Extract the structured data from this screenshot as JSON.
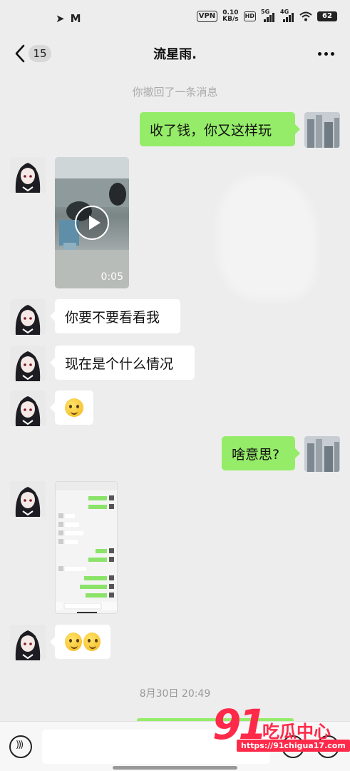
{
  "status_bar": {
    "vpn": "VPN",
    "speed_value": "0.10",
    "speed_unit": "KB/s",
    "hd": "HD",
    "net_5g": "5G",
    "net_4g": "4G",
    "battery": "62",
    "left_icons": [
      "telegram-icon",
      "gmail-icon"
    ]
  },
  "nav": {
    "back_icon": "chevron-left-icon",
    "unread_count": "15",
    "title": "流星雨.",
    "more_icon": "more-dots-icon"
  },
  "messages": {
    "recalled_notice": "你撤回了一条消息",
    "msg1_text": "收了钱，你又这样玩",
    "video_duration": "0:05",
    "msg3_text": "你要不要看看我",
    "msg4_text": "现在是个什么情况",
    "msg5_emoji": "smile-blush-emoji",
    "msg6_text": "啥意思?",
    "msg8_emoji": "two-blush-emoji",
    "timestamp": "8月30日 20:49"
  },
  "input_bar": {
    "voice_icon": "voice-icon",
    "emoji_icon": "emoji-icon",
    "plus_icon": "plus-icon"
  },
  "watermark": {
    "logo_number": "91",
    "title": "吃瓜中心",
    "url": "https://91chigua17.com"
  },
  "colors": {
    "background": "#ededed",
    "outgoing_bubble": "#95ec69",
    "incoming_bubble": "#ffffff",
    "watermark_red": "#ff2a4a"
  }
}
